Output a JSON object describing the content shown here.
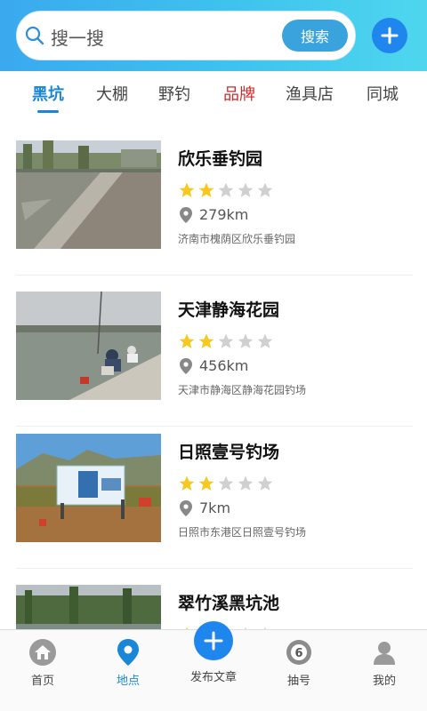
{
  "header": {
    "search_placeholder": "搜一搜",
    "search_button": "搜索",
    "icons": [
      "search-icon",
      "plus-icon"
    ]
  },
  "tabs": [
    {
      "label": "黑坑",
      "active": true
    },
    {
      "label": "大棚"
    },
    {
      "label": "野钓"
    },
    {
      "label": "品牌",
      "color": "#cc2a2a"
    },
    {
      "label": "渔具店"
    },
    {
      "label": "同城"
    }
  ],
  "spots": [
    {
      "name": "欣乐垂钓园",
      "rating": 2,
      "distance": "279km",
      "address": "济南市槐荫区欣乐垂钓园"
    },
    {
      "name": "天津静海花园",
      "rating": 2,
      "distance": "456km",
      "address": "天津市静海区静海花园钓场"
    },
    {
      "name": "日照壹号钓场",
      "rating": 2,
      "distance": "7km",
      "address": "日照市东港区日照壹号钓场"
    },
    {
      "name": "翠竹溪黑坑池",
      "rating": 2,
      "distance": "",
      "address": ""
    }
  ],
  "bottom_nav": {
    "home": "首页",
    "places": "地点",
    "publish": "发布文章",
    "lottery": "抽号",
    "mine": "我的"
  },
  "colors": {
    "accent": "#1a86d8",
    "star_on": "#f7c81e",
    "star_off": "#d0d0d0",
    "header_gradient": [
      "#3aa9ef",
      "#4fd6ee"
    ]
  }
}
